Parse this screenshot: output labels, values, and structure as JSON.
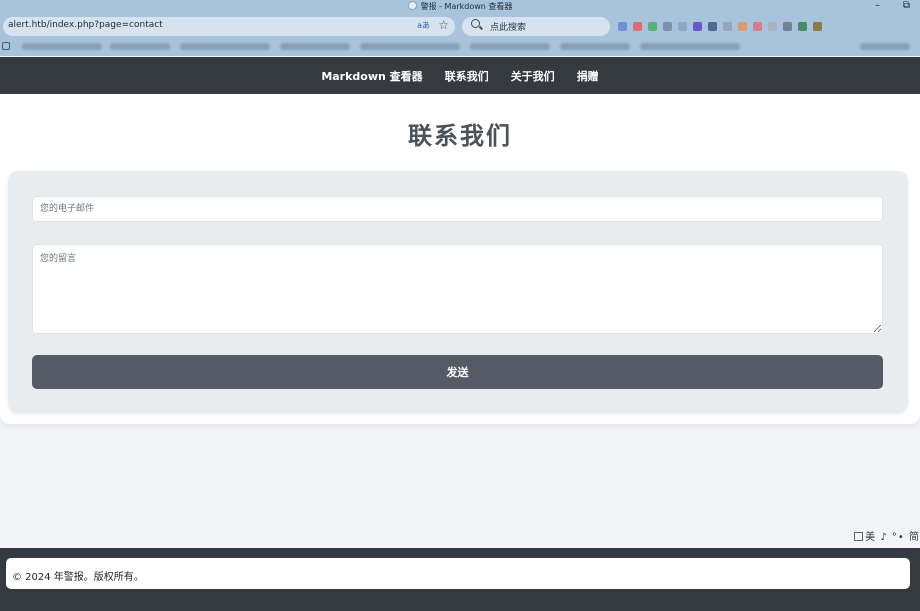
{
  "browser": {
    "window_title": "警报 - Markdown 查看器",
    "url": "alert.htb/index.php?page=contact",
    "reader_mode_label": "aあ",
    "search_placeholder": "点此搜索"
  },
  "nav": {
    "items": [
      {
        "label": "Markdown 查看器"
      },
      {
        "label": "联系我们"
      },
      {
        "label": "关于我们"
      },
      {
        "label": "捐赠"
      }
    ]
  },
  "page": {
    "title": "联系我们"
  },
  "form": {
    "email_placeholder": "您的电子邮件",
    "message_placeholder": "您的留言",
    "submit_label": "发送"
  },
  "ime_toolbar": "美 ♪ °• 简",
  "footer": {
    "text": "© 2024 年警报。版权所有。"
  },
  "colors": {
    "navbar": "#343a40",
    "button": "#545b64",
    "form_bg": "#e9ecef",
    "title": "#4b525a"
  }
}
